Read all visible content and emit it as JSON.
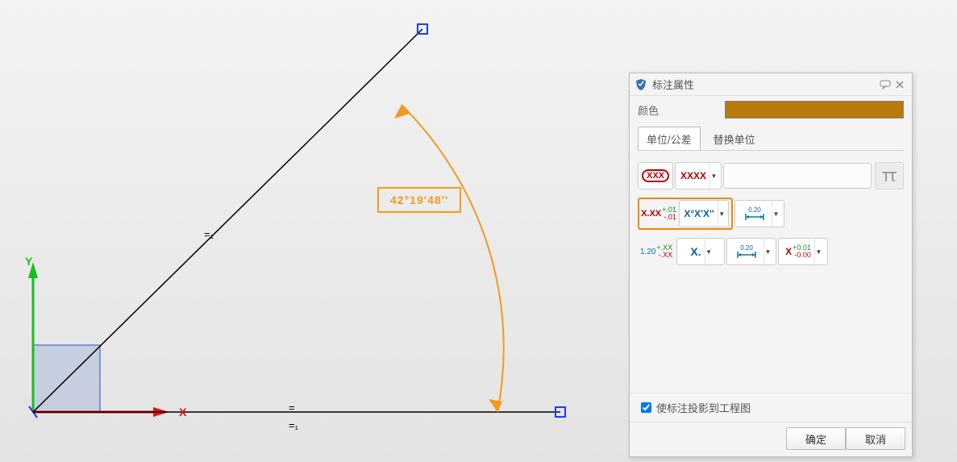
{
  "canvas": {
    "axis_x_label": "X",
    "axis_y_label": "Y",
    "angle_text": "42°19'48''",
    "constraint_top": "=₁",
    "constraint_bot_equal": "=",
    "constraint_bot_sub": "=₁"
  },
  "panel": {
    "title": "标注属性",
    "color_label": "颜色",
    "color_value": "#b87a0b",
    "tabs": {
      "active": "单位/公差",
      "inactive": "替换单位"
    },
    "row1": {
      "round_open": "XXX",
      "precision": "XXXX"
    },
    "row2": {
      "tol_xx_top": "+.01",
      "tol_xx_mid": "X.XX",
      "tol_xx_bot": "-.01",
      "dms": "X°X'X''",
      "gap1": "0.20"
    },
    "row3": {
      "tol_120_top": "+.XX",
      "tol_120_mid": "1.20",
      "tol_120_bot": "-.XX",
      "xdot": "X.",
      "gap2": "0.20",
      "lim_top": "+0.01",
      "lim_x": "X",
      "lim_bot": "-0.00"
    },
    "checkbox_label": "使标注投影到工程图",
    "ok_label": "确定",
    "cancel_label": "取消"
  }
}
